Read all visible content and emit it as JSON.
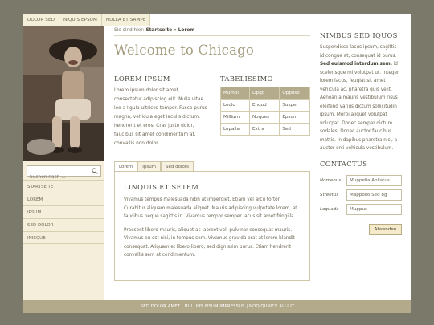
{
  "topnav": [
    "DOLOR SED",
    "NIQUIS EPSUM",
    "NULLA ET SAMPE"
  ],
  "search": {
    "placeholder": "Suchen nach ..."
  },
  "sidebar": [
    "STARTSEITE",
    "LOREM",
    "IPSUM",
    "SED DOLOR",
    "INISQUE"
  ],
  "breadcrumb": {
    "prefix": "Sie sind hier:",
    "current": "Startseite » Lorem"
  },
  "page_title": "Welcome to Chicago",
  "lorem": {
    "heading": "LOREM IPSUM",
    "text": "Lorem ipsum dolor sit amet, consectetur adipiscing elit. Nulla vitae leo a ligula ultrices tempor. Fusce purus magna, vehicula eget iaculis dictum, hendrerit et eros. Cras justo dolor, faucibus sit amet condimentum at, convallis non dolor."
  },
  "table": {
    "heading": "TABELISSIMO",
    "headers": [
      "Mumpi",
      "Lipqo",
      "Opposo"
    ],
    "rows": [
      [
        "Loolo",
        "Enqud",
        "Susper"
      ],
      [
        "Millium",
        "Noques",
        "Epsum"
      ],
      [
        "Lopalla",
        "Extra",
        "Sed"
      ]
    ]
  },
  "tabs": [
    "Lorem",
    "Ipsum",
    "Sed dolors"
  ],
  "tab_panel": {
    "heading": "LINQUIS ET SETEM",
    "p1": "Vivamus tempus malesuada nibh at imperdiet. Etiam vel arcu tortor. Curabitur aliquam malesuada aliquet. Mauris adipiscing vulputate lorem, at faucibus neque sagittis in. Vivamus tempor semper lacus sit amet fringilla.",
    "p2": "Praesent libero mauris, aliquet ac laoreet vel, pulvinar consequat mauris. Vivamus eu est nisi, in tempus sem. Vivamus gravida erat at lorem blandit consequat. Aliquam et libero libero, sed dignissim purus. Etiam hendrerit convallis sem at condimentum."
  },
  "nimbus": {
    "heading": "NIMBUS SED IQUOS",
    "text_before": "Suspendisse lacus ipsum, sagittis id congue at, consequat id purus.",
    "bold": "Sed euismod interdum sem,",
    "text_after": "id scelerisque mi volutpat ut. Integer lorem lacus, feugiat sit amet vehicula ac, pharetra quis velit. Aenean a mauris vestibulum risus eleifend varius dictum sollicitudin ipsum. Morbi aliquet volutpat volutpat. Donec semper dictum sodales. Donec auctor faucibus mattis. In dapibus pharetra nisl, a auctor orci vehicula vestibulum."
  },
  "contact": {
    "heading": "CONTACTUS",
    "fields": [
      {
        "label": "Nomenus",
        "value": "Muppelia Apllatus"
      },
      {
        "label": "Streetus",
        "value": "Mappollo Sed 8g"
      },
      {
        "label": "Loquada",
        "value": "Muppus"
      }
    ],
    "submit": "Absenden"
  },
  "footer": "SED DOLOR AMET | NULLIUS IPSUM IMPRESSUS | NOQ QUNICE ALLIUT",
  "colors": {
    "background": "#7b7a6a",
    "accent": "#b4ab8c",
    "footer": "#b3aa8c"
  }
}
